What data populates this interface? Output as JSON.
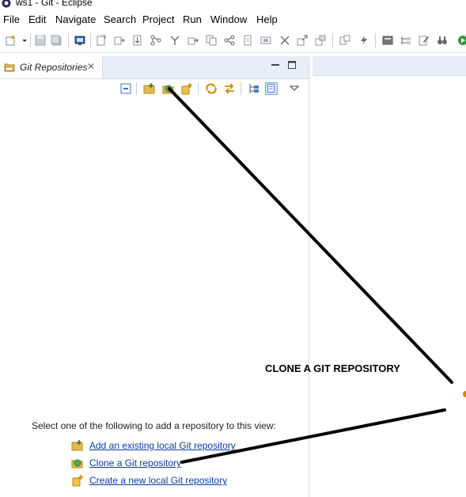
{
  "window": {
    "title": "ws1 - Git - Eclipse"
  },
  "menubar": {
    "items": [
      "File",
      "Edit",
      "Navigate",
      "Search",
      "Project",
      "Run",
      "Window",
      "Help"
    ]
  },
  "view": {
    "tab_label": "Git Repositories",
    "close_glyph": "✕"
  },
  "empty_state": {
    "intro": "Select one of the following to add a repository to this view:",
    "links": [
      {
        "label": "Add an existing local Git repository",
        "icon": "folder-add-icon"
      },
      {
        "label": "Clone a Git repository",
        "icon": "clone-icon"
      },
      {
        "label": "Create a new local Git repository",
        "icon": "new-repo-icon"
      }
    ]
  },
  "annotation": {
    "text": "CLONE A GIT REPOSITORY"
  },
  "colors": {
    "link": "#0b3c9e",
    "tab_bar": "#e8eef7",
    "annotation_line": "#000000"
  }
}
